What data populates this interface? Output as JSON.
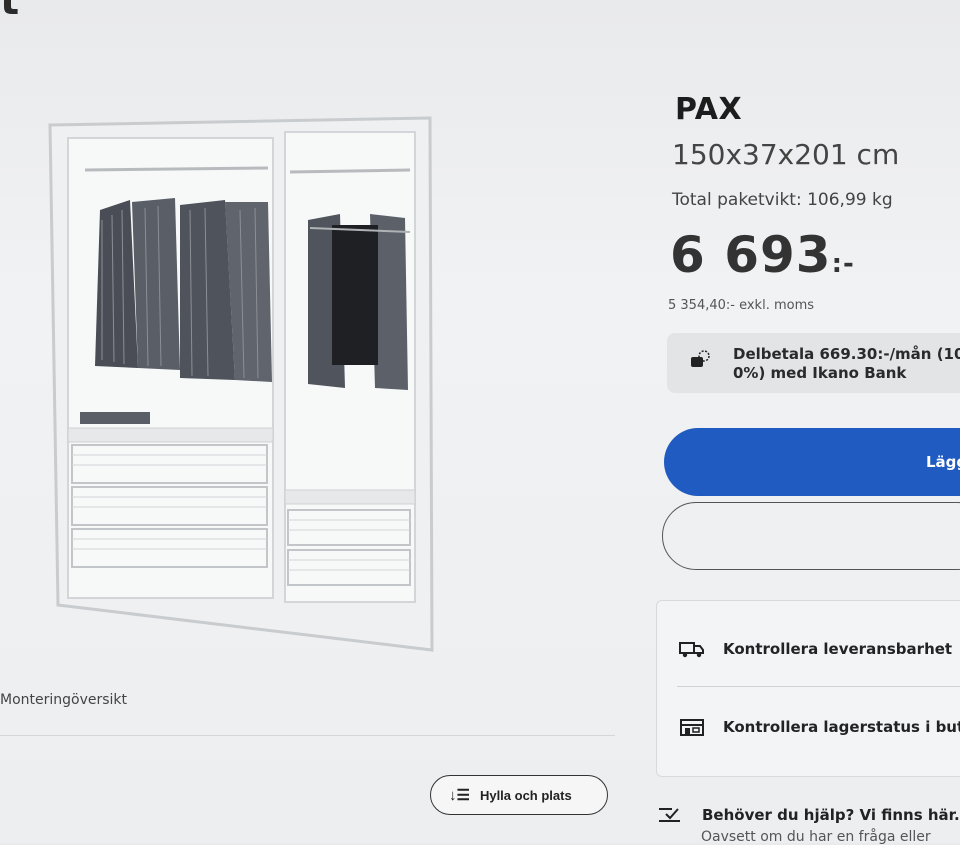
{
  "page": {
    "title_fragment": "t"
  },
  "product": {
    "name": "PAX",
    "dimensions": "150x37x201 cm",
    "package_weight": "Total paketvikt: 106,99 kg",
    "price_main": "6 693",
    "price_suffix": ":-",
    "price_ex_vat": "5 354,40:- exkl. moms"
  },
  "installment": {
    "text": "Delbetala 669.30:-/mån (10 0%) med Ikano Bank"
  },
  "actions": {
    "add_to_cart_label": "Lägg"
  },
  "gallery": {
    "caption": "Monteringöversikt",
    "filter_label": "Hylla och plats"
  },
  "availability": {
    "delivery_label": "Kontrollera leveransbarhet",
    "store_label": "Kontrollera lagerstatus i butik"
  },
  "help": {
    "title": "Behöver du hjälp? Vi finns här.",
    "subtitle": "Oavsett om du har en fråga eller"
  },
  "colors": {
    "accent": "#1f5bc0",
    "background": "#eceef0"
  }
}
